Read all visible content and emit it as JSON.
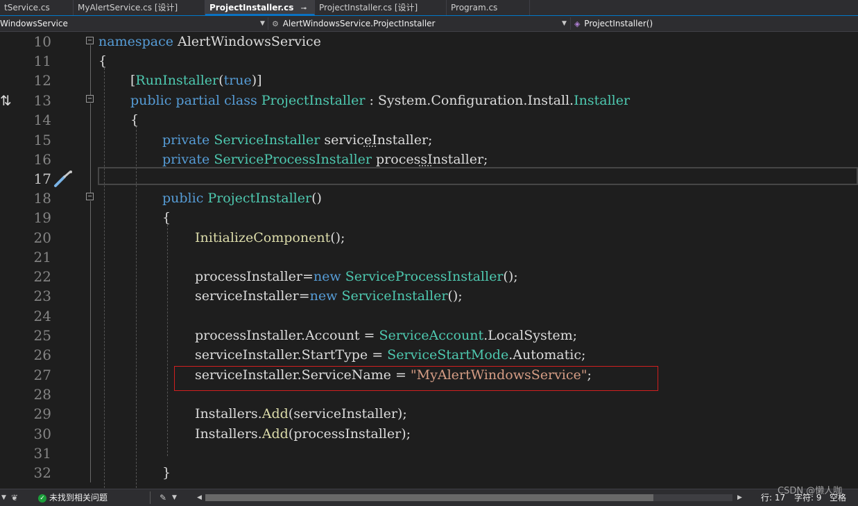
{
  "tabs": [
    {
      "label": "tService.cs"
    },
    {
      "label": "MyAlertService.cs [设计]"
    },
    {
      "label": "ProjectInstaller.cs",
      "pin": "⊸",
      "close": "×"
    },
    {
      "label": "ProjectInstaller.cs [设计]"
    },
    {
      "label": "Program.cs"
    }
  ],
  "nav": {
    "project": "WindowsService",
    "type": "AlertWindowsService.ProjectInstaller",
    "member": "ProjectInstaller()"
  },
  "editor": {
    "line_numbers": [
      "10",
      "11",
      "12",
      "13",
      "14",
      "15",
      "16",
      "17",
      "18",
      "19",
      "20",
      "21",
      "22",
      "23",
      "24",
      "25",
      "26",
      "27",
      "28",
      "29",
      "30",
      "31",
      "32"
    ],
    "current_line": "17",
    "lines": {
      "l10": [
        "namespace",
        " AlertWindowsService"
      ],
      "l11": [
        "{"
      ],
      "l12": [
        "[",
        "RunInstaller",
        "(",
        "true",
        ")]"
      ],
      "l13": [
        "public",
        " ",
        "partial",
        " ",
        "class",
        " ",
        "ProjectInstaller",
        " : System.Configuration.Install.",
        "Installer"
      ],
      "l14": [
        "{"
      ],
      "l15": [
        "private",
        " ",
        "ServiceInstaller",
        " serviceInstaller;"
      ],
      "l16": [
        "private",
        " ",
        "ServiceProcessInstaller",
        " processInstaller;"
      ],
      "l18": [
        "public",
        " ",
        "ProjectInstaller",
        "()"
      ],
      "l19": [
        "{"
      ],
      "l20": [
        "InitializeComponent",
        "();"
      ],
      "l22": [
        "processInstaller=",
        "new",
        " ",
        "ServiceProcessInstaller",
        "();"
      ],
      "l23": [
        "serviceInstaller=",
        "new",
        " ",
        "ServiceInstaller",
        "();"
      ],
      "l25": [
        "processInstaller.Account = ",
        "ServiceAccount",
        ".LocalSystem;"
      ],
      "l26": [
        "serviceInstaller.StartType = ",
        "ServiceStartMode",
        ".Automatic;"
      ],
      "l27": [
        "serviceInstaller.ServiceName = ",
        "\"MyAlertWindowsService\"",
        ";"
      ],
      "l29": [
        "Installers.",
        "Add",
        "(serviceInstaller);"
      ],
      "l30": [
        "Installers.",
        "Add",
        "(processInstaller);"
      ],
      "l32": [
        "}"
      ]
    }
  },
  "status": {
    "issues": "未找到相关问题",
    "line_label": "行: 17",
    "char_label": "字符: 9",
    "space_label": "空格"
  },
  "watermark": "CSDN @懒人咖"
}
